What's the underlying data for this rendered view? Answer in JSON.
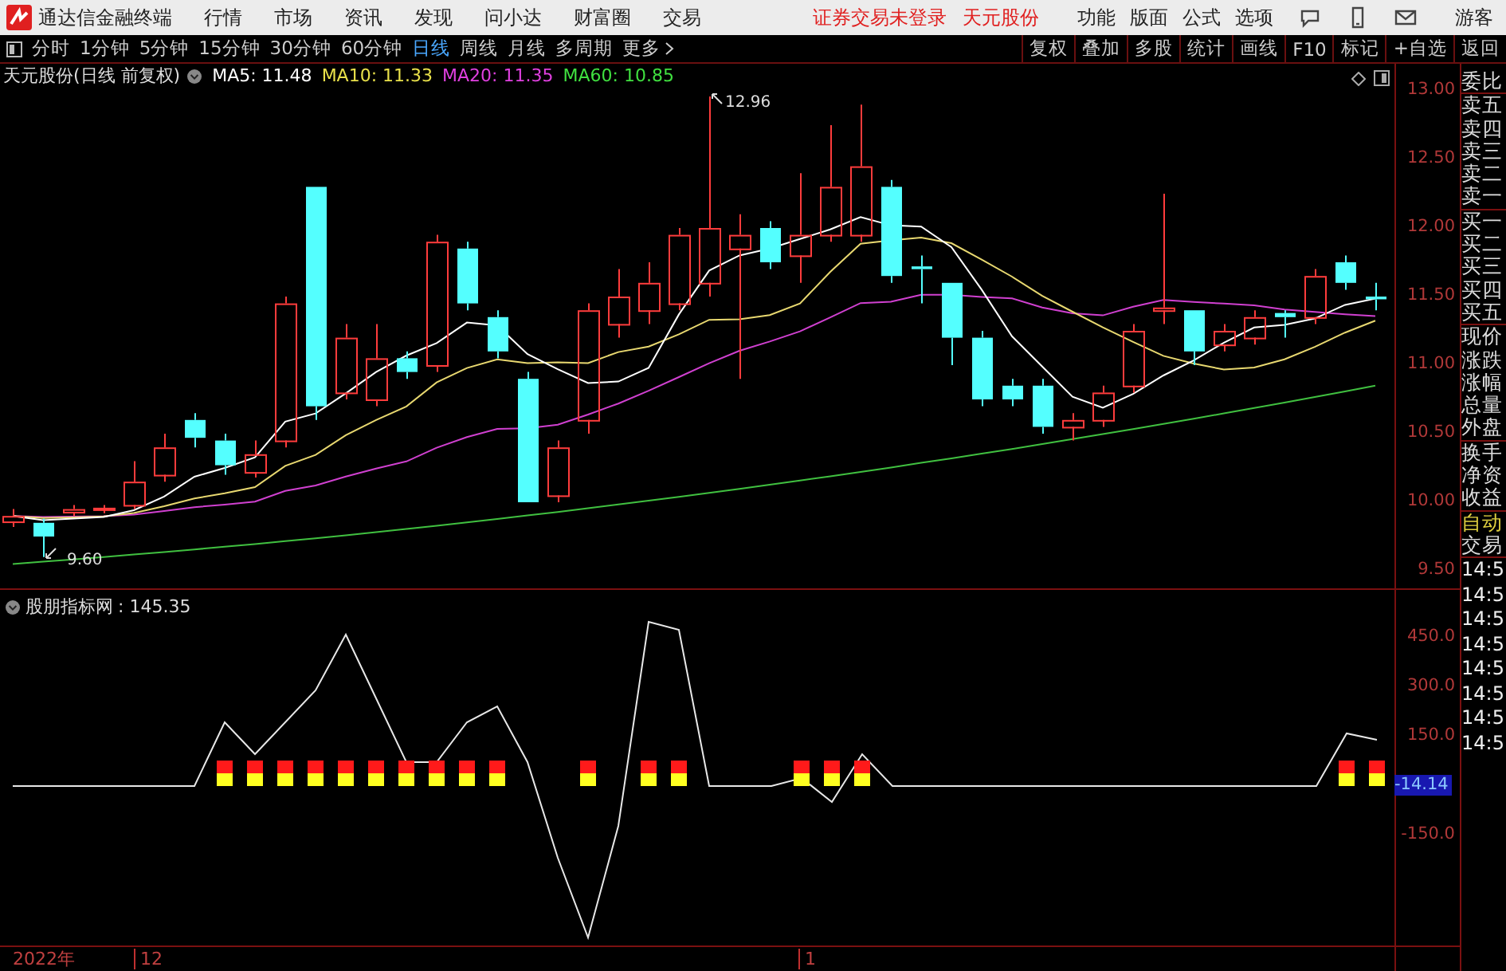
{
  "app_bar": {
    "title": "通达信金融终端",
    "menu": [
      "行情",
      "市场",
      "资讯",
      "发现",
      "问小达",
      "财富圈",
      "交易"
    ],
    "notices": [
      "证券交易未登录",
      "天元股份"
    ],
    "right_menu": [
      "功能",
      "版面",
      "公式",
      "选项"
    ],
    "user": "游客"
  },
  "toolbar": {
    "periods": [
      {
        "label": "分时",
        "selected": false
      },
      {
        "label": "1分钟",
        "selected": false
      },
      {
        "label": "5分钟",
        "selected": false
      },
      {
        "label": "15分钟",
        "selected": false
      },
      {
        "label": "30分钟",
        "selected": false
      },
      {
        "label": "60分钟",
        "selected": false
      },
      {
        "label": "日线",
        "selected": true
      },
      {
        "label": "周线",
        "selected": false
      },
      {
        "label": "月线",
        "selected": false
      },
      {
        "label": "多周期",
        "selected": false
      }
    ],
    "more": "更多",
    "actions": [
      "复权",
      "叠加",
      "多股",
      "统计",
      "画线",
      "F10",
      "标记",
      "+自选",
      "返回"
    ]
  },
  "chart_header": {
    "title": "天元股份(日线 前复权)",
    "ma": [
      {
        "label": "MA5: 11.48",
        "color": "#ffffff"
      },
      {
        "label": "MA10: 11.33",
        "color": "#e8e04a"
      },
      {
        "label": "MA20: 11.35",
        "color": "#e040e0"
      },
      {
        "label": "MA60: 10.85",
        "color": "#40e040"
      }
    ]
  },
  "price_axis": [
    "13.00",
    "12.50",
    "12.00",
    "11.50",
    "11.00",
    "10.50",
    "10.00",
    "9.50"
  ],
  "annotations": {
    "high": "12.96",
    "low": "9.60"
  },
  "indicator": {
    "title": "股朋指标网",
    "value": ": 145.35",
    "axis": [
      "450.0",
      "300.0",
      "150.0",
      "-150.0"
    ],
    "current": "-14.14"
  },
  "date_axis": [
    "2022年",
    "12",
    "1"
  ],
  "quote_panel": {
    "sections": [
      {
        "kind": "label",
        "items": [
          "委比"
        ]
      },
      {
        "kind": "label",
        "items": [
          "卖五",
          "卖四",
          "卖三",
          "卖二",
          "卖一"
        ]
      },
      {
        "kind": "label",
        "items": [
          "买一",
          "买二",
          "买三",
          "买四",
          "买五"
        ]
      },
      {
        "kind": "label",
        "items": [
          "现价",
          "涨跌",
          "涨幅",
          "总量",
          "外盘"
        ]
      },
      {
        "kind": "label",
        "items": [
          "换手",
          "净资",
          "收益"
        ]
      },
      {
        "kind": "mode",
        "items": [
          "自动",
          "交易"
        ]
      },
      {
        "kind": "time",
        "items": [
          "14:5",
          "14:5",
          "14:5",
          "14:5",
          "14:5",
          "14:5",
          "14:5",
          "14:5"
        ]
      }
    ]
  }
}
